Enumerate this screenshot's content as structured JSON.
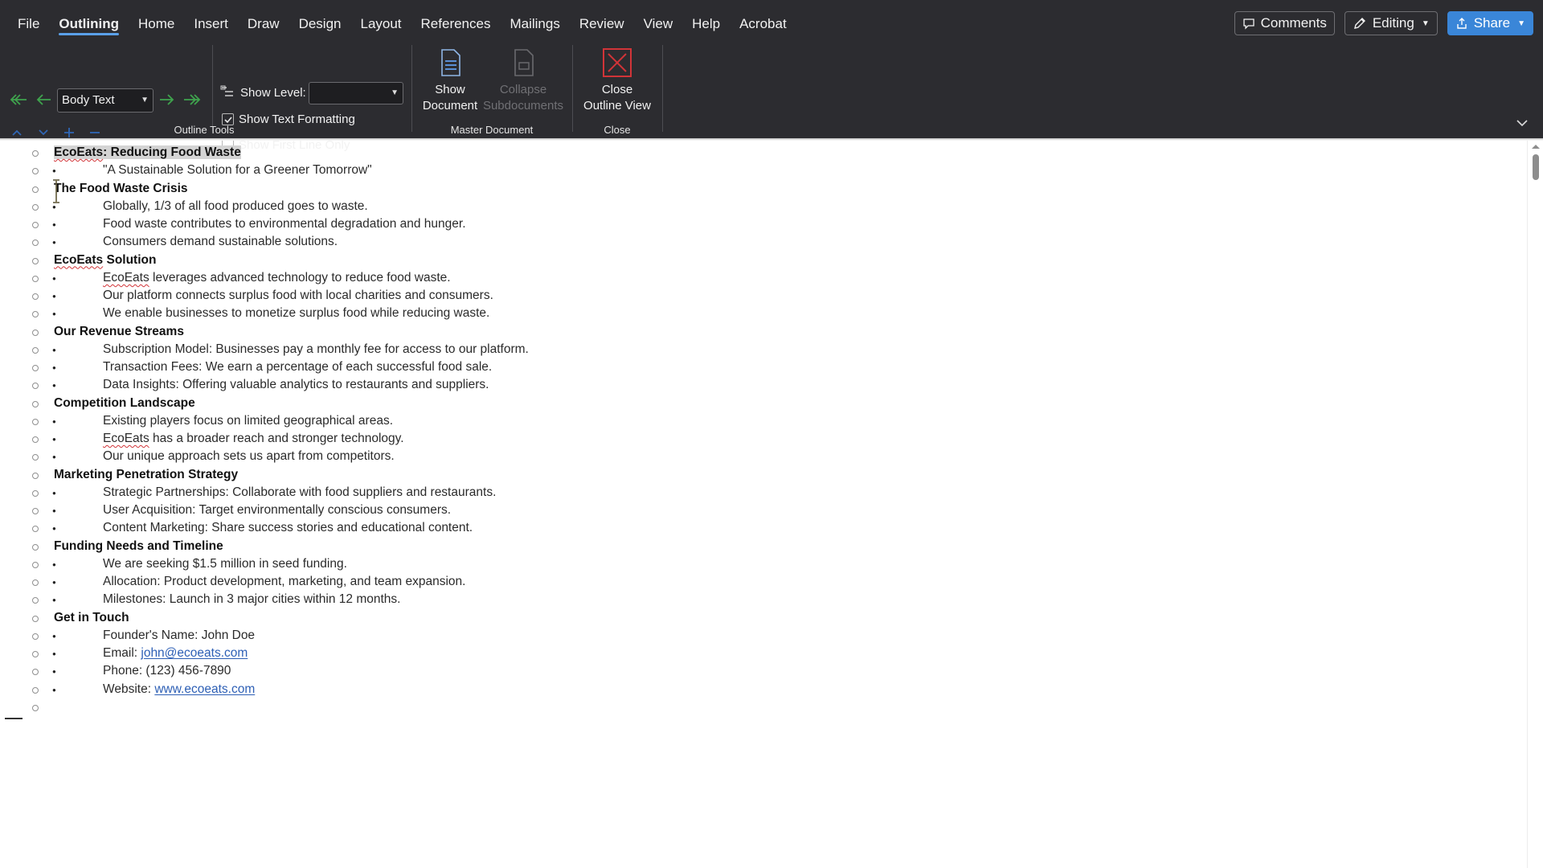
{
  "menu": {
    "tabs": [
      "File",
      "Outlining",
      "Home",
      "Insert",
      "Draw",
      "Design",
      "Layout",
      "References",
      "Mailings",
      "Review",
      "View",
      "Help",
      "Acrobat"
    ],
    "active_tab": "Outlining",
    "comments_label": "Comments",
    "editing_label": "Editing",
    "share_label": "Share"
  },
  "ribbon": {
    "outline_tools": {
      "level_value": "Body Text",
      "show_level_label": "Show Level:",
      "show_level_value": "",
      "show_text_formatting_label": "Show Text Formatting",
      "show_text_formatting_checked": true,
      "show_first_line_only_label": "Show First Line Only",
      "show_first_line_only_checked": false,
      "group_label": "Outline Tools"
    },
    "master_document": {
      "show_document_label_1": "Show",
      "show_document_label_2": "Document",
      "collapse_label_1": "Collapse",
      "collapse_label_2": "Subdocuments",
      "group_label": "Master Document"
    },
    "close": {
      "close_label_1": "Close",
      "close_label_2": "Outline View",
      "group_label": "Close"
    }
  },
  "outline": [
    {
      "type": "h",
      "segments": [
        {
          "text": "EcoEats",
          "style": "sel sq"
        },
        {
          "text": ": Reducing Food Waste",
          "style": "sel"
        }
      ]
    },
    {
      "type": "b",
      "segments": [
        {
          "text": "\"A Sustainable Solution for a Greener Tomorrow\""
        }
      ]
    },
    {
      "type": "h",
      "segments": [
        {
          "text": "The Food Waste Crisis"
        }
      ]
    },
    {
      "type": "b",
      "segments": [
        {
          "text": "Globally, 1/3 of all food produced goes to waste."
        }
      ]
    },
    {
      "type": "b",
      "segments": [
        {
          "text": "Food waste contributes to environmental degradation and hunger."
        }
      ]
    },
    {
      "type": "b",
      "segments": [
        {
          "text": "Consumers demand sustainable solutions."
        }
      ]
    },
    {
      "type": "h",
      "segments": [
        {
          "text": "EcoEats",
          "style": "sq"
        },
        {
          "text": " Solution"
        }
      ]
    },
    {
      "type": "b",
      "segments": [
        {
          "text": "EcoEats",
          "style": "sq"
        },
        {
          "text": " leverages advanced technology to reduce food waste."
        }
      ]
    },
    {
      "type": "b",
      "segments": [
        {
          "text": "Our platform connects surplus food with local charities and consumers."
        }
      ]
    },
    {
      "type": "b",
      "segments": [
        {
          "text": "We enable businesses to monetize surplus food while reducing waste."
        }
      ]
    },
    {
      "type": "h",
      "segments": [
        {
          "text": "Our Revenue Streams"
        }
      ]
    },
    {
      "type": "b",
      "segments": [
        {
          "text": "Subscription Model: Businesses pay a monthly fee for access to our platform."
        }
      ]
    },
    {
      "type": "b",
      "segments": [
        {
          "text": "Transaction Fees: We earn a percentage of each successful food sale."
        }
      ]
    },
    {
      "type": "b",
      "segments": [
        {
          "text": "Data Insights: Offering valuable analytics to restaurants and suppliers."
        }
      ]
    },
    {
      "type": "h",
      "segments": [
        {
          "text": "Competition Landscape"
        }
      ]
    },
    {
      "type": "b",
      "segments": [
        {
          "text": "Existing players focus on limited geographical areas."
        }
      ]
    },
    {
      "type": "b",
      "segments": [
        {
          "text": "EcoEats",
          "style": "sq"
        },
        {
          "text": " has a broader reach and stronger technology."
        }
      ]
    },
    {
      "type": "b",
      "segments": [
        {
          "text": "Our unique approach sets us apart from competitors."
        }
      ]
    },
    {
      "type": "h",
      "segments": [
        {
          "text": "Marketing Penetration Strategy"
        }
      ]
    },
    {
      "type": "b",
      "segments": [
        {
          "text": "Strategic Partnerships: Collaborate with food suppliers and restaurants."
        }
      ]
    },
    {
      "type": "b",
      "segments": [
        {
          "text": "User Acquisition: Target environmentally conscious consumers."
        }
      ]
    },
    {
      "type": "b",
      "segments": [
        {
          "text": "Content Marketing: Share success stories and educational content."
        }
      ]
    },
    {
      "type": "h",
      "segments": [
        {
          "text": "Funding Needs and Timeline"
        }
      ]
    },
    {
      "type": "b",
      "segments": [
        {
          "text": "We are seeking $1.5 million in seed funding."
        }
      ]
    },
    {
      "type": "b",
      "segments": [
        {
          "text": "Allocation: Product development, marketing, and team expansion."
        }
      ]
    },
    {
      "type": "b",
      "segments": [
        {
          "text": "Milestones: Launch in 3 major cities within 12 months."
        }
      ]
    },
    {
      "type": "h",
      "segments": [
        {
          "text": "Get in Touch"
        }
      ]
    },
    {
      "type": "b",
      "segments": [
        {
          "text": "Founder's Name: John Doe"
        }
      ]
    },
    {
      "type": "b",
      "segments": [
        {
          "text": "Email: "
        },
        {
          "text": "john@ecoeats.com",
          "style": "lnk"
        }
      ]
    },
    {
      "type": "b",
      "segments": [
        {
          "text": "Phone: (123) 456-7890"
        }
      ]
    },
    {
      "type": "b",
      "segments": [
        {
          "text": "Website: "
        },
        {
          "text": "www.ecoeats.com",
          "style": "lnk"
        }
      ]
    },
    {
      "type": "e",
      "segments": []
    }
  ],
  "colors": {
    "chrome": "#2c2c30",
    "accent": "#3a86d8",
    "link": "#2d5fb5",
    "close_red": "#d13438"
  }
}
